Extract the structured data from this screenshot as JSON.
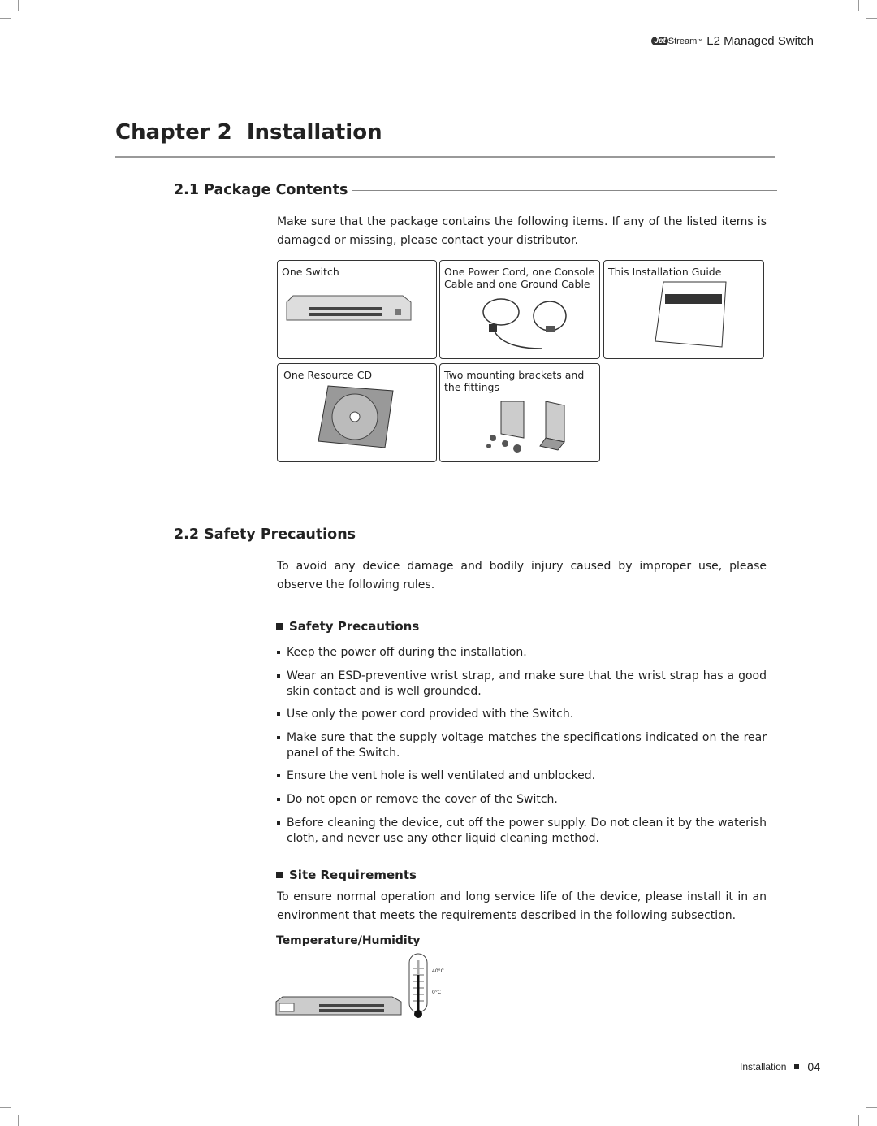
{
  "header": {
    "logo_text": "JetStream",
    "product": "L2 Managed Switch"
  },
  "chapter": {
    "title": "Chapter 2  Installation"
  },
  "section1": {
    "title": "2.1 Package Contents",
    "intro": "Make sure that the package contains the following items. If any of the listed items is damaged or missing, please contact your distributor.",
    "items": [
      {
        "label": "One Switch"
      },
      {
        "label": "One Power Cord, one Console Cable and one Ground Cable"
      },
      {
        "label": "This Installation Guide"
      },
      {
        "label": "One Resource CD"
      },
      {
        "label": "Two mounting brackets and the fittings"
      }
    ]
  },
  "section2": {
    "title": "2.2 Safety Precautions",
    "intro": "To avoid any device damage and bodily injury caused by improper use, please observe the following rules.",
    "safety": {
      "title": "Safety Precautions",
      "rules": [
        "Keep the power off during the installation.",
        "Wear an ESD-preventive wrist strap, and make sure that the wrist strap has a good skin contact and is well grounded.",
        "Use only the power cord provided with the Switch.",
        "Make sure that the supply voltage matches the specifications indicated on the rear panel of the Switch.",
        "Ensure the vent hole is well ventilated and unblocked.",
        "Do not open or remove the cover of the Switch.",
        "Before cleaning the device, cut off the power supply. Do not clean it by the waterish cloth, and never use any other liquid cleaning method."
      ]
    },
    "site": {
      "title": "Site Requirements",
      "text": "To ensure normal operation and long service life of the device, please install it in an environment that meets the requirements described in the following subsection.",
      "temp_title": "Temperature/Humidity",
      "temp_high": "40°C",
      "temp_low": "0°C"
    }
  },
  "footer": {
    "section": "Installation",
    "page": "04"
  }
}
